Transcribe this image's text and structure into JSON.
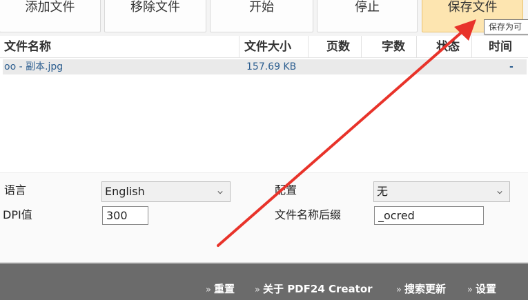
{
  "toolbar": {
    "add_files": "添加文件",
    "remove_files": "移除文件",
    "start": "开始",
    "stop": "停止",
    "save_files": "保存文件",
    "tooltip": "保存为可"
  },
  "table": {
    "headers": {
      "name": "文件名称",
      "size": "文件大小",
      "pages": "页数",
      "words": "字数",
      "status": "状态",
      "time": "时间"
    },
    "rows": [
      {
        "name": "oo - 副本.jpg",
        "size": "157.69 KB",
        "time": "-"
      }
    ]
  },
  "settings": {
    "language_label": "语言",
    "language_value": "English",
    "config_label": "配置",
    "config_value": "无",
    "dpi_label": "DPI值",
    "dpi_value": "300",
    "suffix_label": "文件名称后缀",
    "suffix_value": "_ocred"
  },
  "footer": {
    "links": [
      "重置",
      "关于 PDF24 Creator",
      "搜索更新",
      "设置"
    ],
    "link_prefix": "»"
  },
  "colors": {
    "accent_button": "#fde5b0",
    "footer_bg": "#6b6b6b",
    "link_text": "#2b5d8f",
    "annotation_arrow": "#e8332a"
  },
  "icons": {
    "dropdown": "chevron-down-icon",
    "annotation": "red-arrow-icon"
  }
}
